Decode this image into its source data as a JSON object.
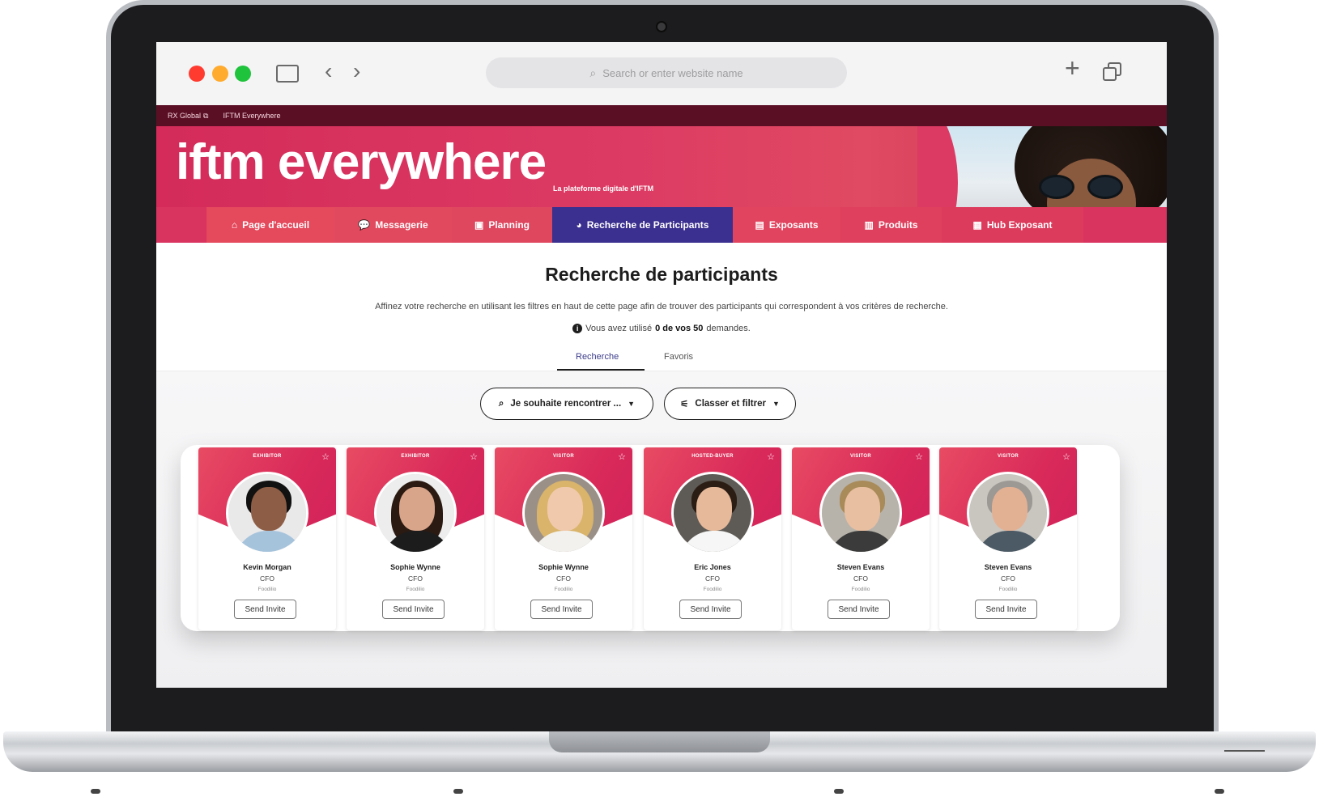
{
  "browser": {
    "address_placeholder": "Search or enter website name",
    "icons": [
      "sidebar-icon",
      "back-icon",
      "forward-icon",
      "search-icon",
      "new-tab-icon",
      "tabs-overview-icon"
    ]
  },
  "topstrip": {
    "links": [
      "RX Global",
      "IFTM Everywhere"
    ]
  },
  "banner": {
    "logo_text": "iftm everywhere",
    "logo_subtitle": "La plateforme digitale d'IFTM",
    "brand_color": "#d93460"
  },
  "nav": {
    "items": [
      {
        "label": "Page d'accueil",
        "icon": "home-icon"
      },
      {
        "label": "Messagerie",
        "icon": "chat-icon"
      },
      {
        "label": "Planning",
        "icon": "calendar-icon"
      },
      {
        "label": "Recherche de Participants",
        "icon": "participants-icon",
        "active": true
      },
      {
        "label": "Exposants",
        "icon": "exhibitor-icon"
      },
      {
        "label": "Produits",
        "icon": "product-icon"
      },
      {
        "label": "Hub Exposant",
        "icon": "hub-icon"
      }
    ],
    "active_color": "#3b2f8f"
  },
  "main": {
    "title": "Recherche de participants",
    "description": "Affinez votre recherche en utilisant les filtres en haut de cette page afin de trouver des participants qui correspondent à vos critères de recherche.",
    "quota_prefix": "Vous avez utilisé",
    "quota_value": "0 de vos 50",
    "quota_suffix": "demandes.",
    "tabs": [
      "Recherche",
      "Favoris"
    ],
    "filter_meet": "Je souhaite rencontrer ...",
    "filter_sort": "Classer et filtrer"
  },
  "cards": [
    {
      "role": "EXHIBITOR",
      "name": "Kevin Morgan",
      "title": "CFO",
      "company": "Foodilio",
      "button": "Send Invite"
    },
    {
      "role": "EXHIBITOR",
      "name": "Sophie Wynne",
      "title": "CFO",
      "company": "Foodilio",
      "button": "Send Invite"
    },
    {
      "role": "VISITOR",
      "name": "Sophie Wynne",
      "title": "CFO",
      "company": "Foodilio",
      "button": "Send Invite"
    },
    {
      "role": "HOSTED-BUYER",
      "name": "Eric Jones",
      "title": "CFO",
      "company": "Foodilio",
      "button": "Send Invite"
    },
    {
      "role": "VISITOR",
      "name": "Steven Evans",
      "title": "CFO",
      "company": "Foodilio",
      "button": "Send Invite"
    },
    {
      "role": "VISITOR",
      "name": "Steven Evans",
      "title": "CFO",
      "company": "Foodilio",
      "button": "Send Invite"
    }
  ]
}
